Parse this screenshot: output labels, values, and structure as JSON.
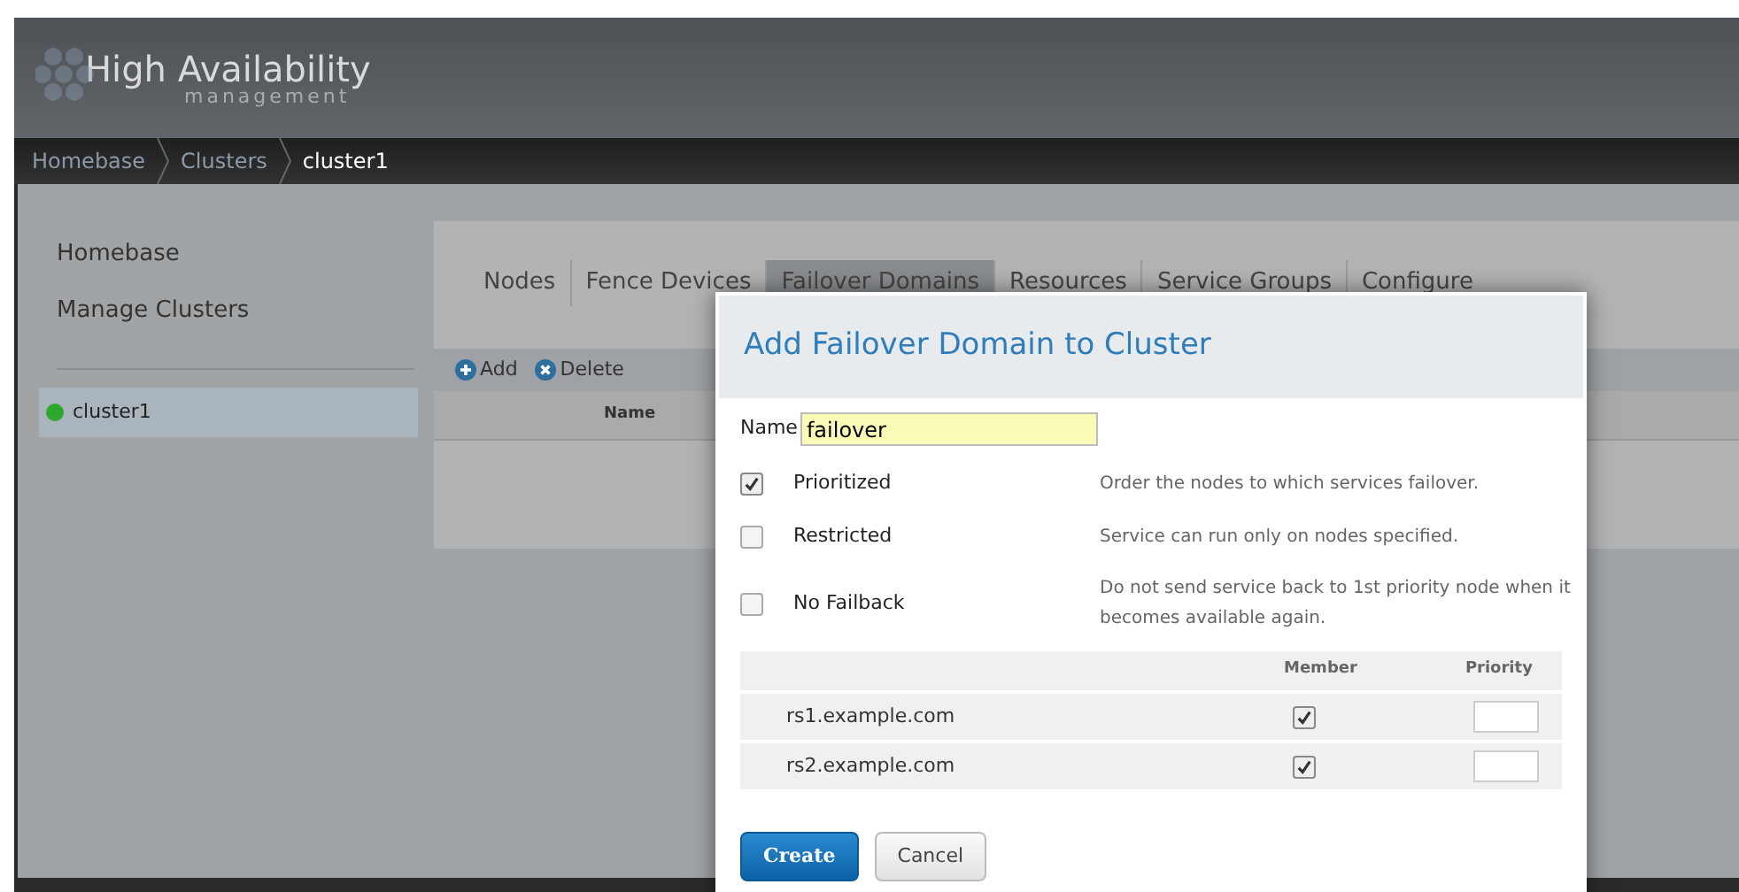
{
  "header": {
    "title": "High Availability",
    "subtitle": "management"
  },
  "breadcrumb": [
    {
      "label": "Homebase",
      "current": false
    },
    {
      "label": "Clusters",
      "current": false
    },
    {
      "label": "cluster1",
      "current": true
    }
  ],
  "sidebar": {
    "links": [
      "Homebase",
      "Manage Clusters"
    ],
    "clusters": [
      {
        "name": "cluster1",
        "color": "#2fa82f",
        "selected": true
      }
    ]
  },
  "tabs": [
    {
      "label": "Nodes",
      "selected": false
    },
    {
      "label": "Fence Devices",
      "selected": false
    },
    {
      "label": "Failover Domains",
      "selected": true
    },
    {
      "label": "Resources",
      "selected": false
    },
    {
      "label": "Service Groups",
      "selected": false
    },
    {
      "label": "Configure",
      "selected": false
    }
  ],
  "toolbar": [
    {
      "label": "Add",
      "kind": "add"
    },
    {
      "label": "Delete",
      "kind": "delete"
    }
  ],
  "table": {
    "columns": [
      "Name"
    ]
  },
  "dialog": {
    "title": "Add Failover Domain to Cluster",
    "name_label": "Name",
    "name_value": "failover",
    "options": [
      {
        "label": "Prioritized",
        "checked": true,
        "description": "Order the nodes to which services failover."
      },
      {
        "label": "Restricted",
        "checked": false,
        "description": "Service can run only on nodes specified."
      },
      {
        "label": "No Failback",
        "checked": false,
        "description": "Do not send service back to 1st priority node when it becomes available again."
      }
    ],
    "node_columns": [
      "Member",
      "Priority"
    ],
    "nodes": [
      {
        "name": "rs1.example.com",
        "member": true
      },
      {
        "name": "rs2.example.com",
        "member": true
      }
    ],
    "buttons": [
      {
        "label": "Create",
        "kind": "primary"
      },
      {
        "label": "Cancel",
        "kind": "secondary"
      }
    ]
  }
}
